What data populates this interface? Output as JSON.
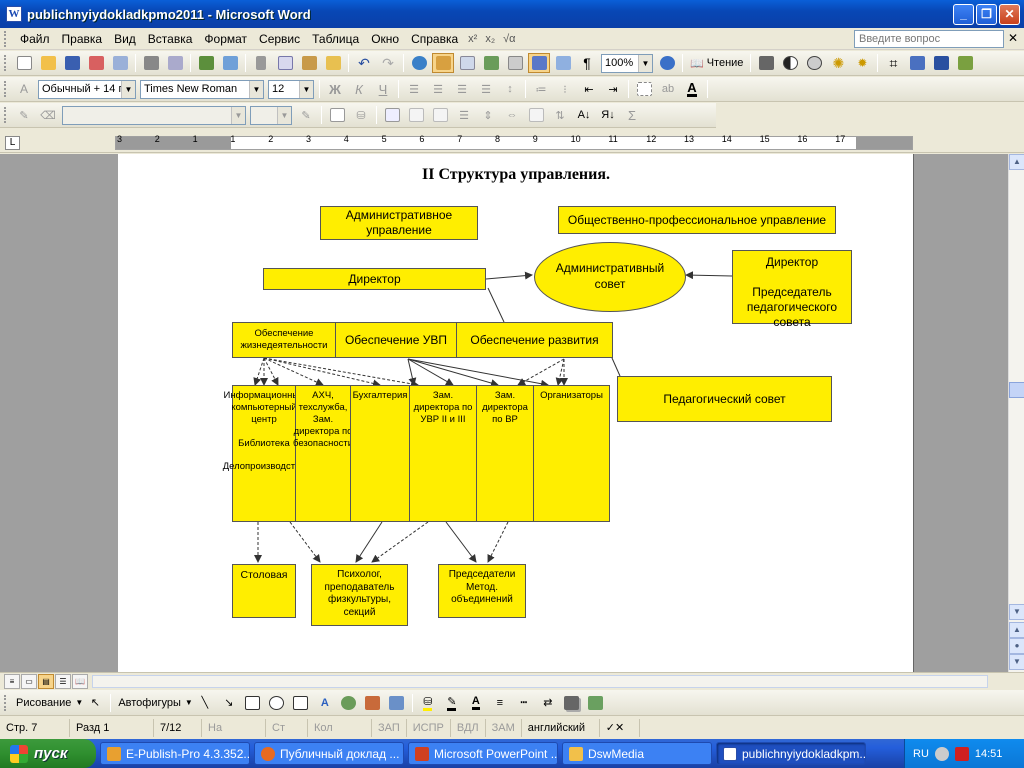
{
  "window": {
    "title": "publichnyiydokladkpmo2011 - Microsoft Word"
  },
  "menu": {
    "items": [
      "Файл",
      "Правка",
      "Вид",
      "Вставка",
      "Формат",
      "Сервис",
      "Таблица",
      "Окно",
      "Справка"
    ],
    "ask_placeholder": "Введите вопрос"
  },
  "toolbar": {
    "zoom": "100%",
    "reading_label": "Чтение",
    "style": "Обычный + 14 г",
    "font": "Times New Roman",
    "size": "12"
  },
  "ruler": {
    "numbers": [
      "3",
      "2",
      "1",
      "1",
      "2",
      "3",
      "4",
      "5",
      "6",
      "7",
      "8",
      "9",
      "10",
      "11",
      "12",
      "13",
      "14",
      "15",
      "16",
      "17"
    ]
  },
  "diagram": {
    "title": "II Структура управления.",
    "admin_mgmt": "Административное управление",
    "public_mgmt": "Общественно-профессиональное управление",
    "director": "Директор",
    "admin_council": "Административный совет",
    "director_chair": "Директор\n\nПредседатель педагогического совета",
    "support_life": "Обеспечение жизнедеятельности",
    "support_uvp": "Обеспечение УВП",
    "support_dev": "Обеспечение развития",
    "ped_council": "Педагогический совет",
    "col1": "Информационный компьютерный центр\n\nБиблиотека\n\nДелопроизводство",
    "col2": "АХЧ, техслужба, Зам. директора по безопасности",
    "col3": "Бухгалтерия",
    "col4": "Зам. директора по УВР II и III",
    "col5": "Зам. директора по ВР",
    "col6": "Организаторы",
    "canteen": "Столовая",
    "psych": "Психолог, преподаватель физкультуры, секций",
    "chairs": "Председатели Метод. объединений"
  },
  "drawing": {
    "draw_label": "Рисование",
    "autoshapes_label": "Автофигуры"
  },
  "status": {
    "page": "Стр. 7",
    "section": "Разд 1",
    "pages": "7/12",
    "at": "На",
    "line": "Ст",
    "col": "Кол",
    "rec": "ЗАП",
    "trk": "ИСПР",
    "ext": "ВДЛ",
    "ovr": "ЗАМ",
    "lang": "английский"
  },
  "taskbar": {
    "start": "пуск",
    "tasks": [
      "E-Publish-Pro 4.3.352...",
      "Публичный доклад ...",
      "Microsoft PowerPoint ...",
      "DswMedia",
      "publichnyiydokladkpm..."
    ],
    "lang": "RU",
    "clock": "14:51"
  },
  "colors": {
    "accent": "#0a5fd8",
    "box_fill": "#ffee00"
  }
}
